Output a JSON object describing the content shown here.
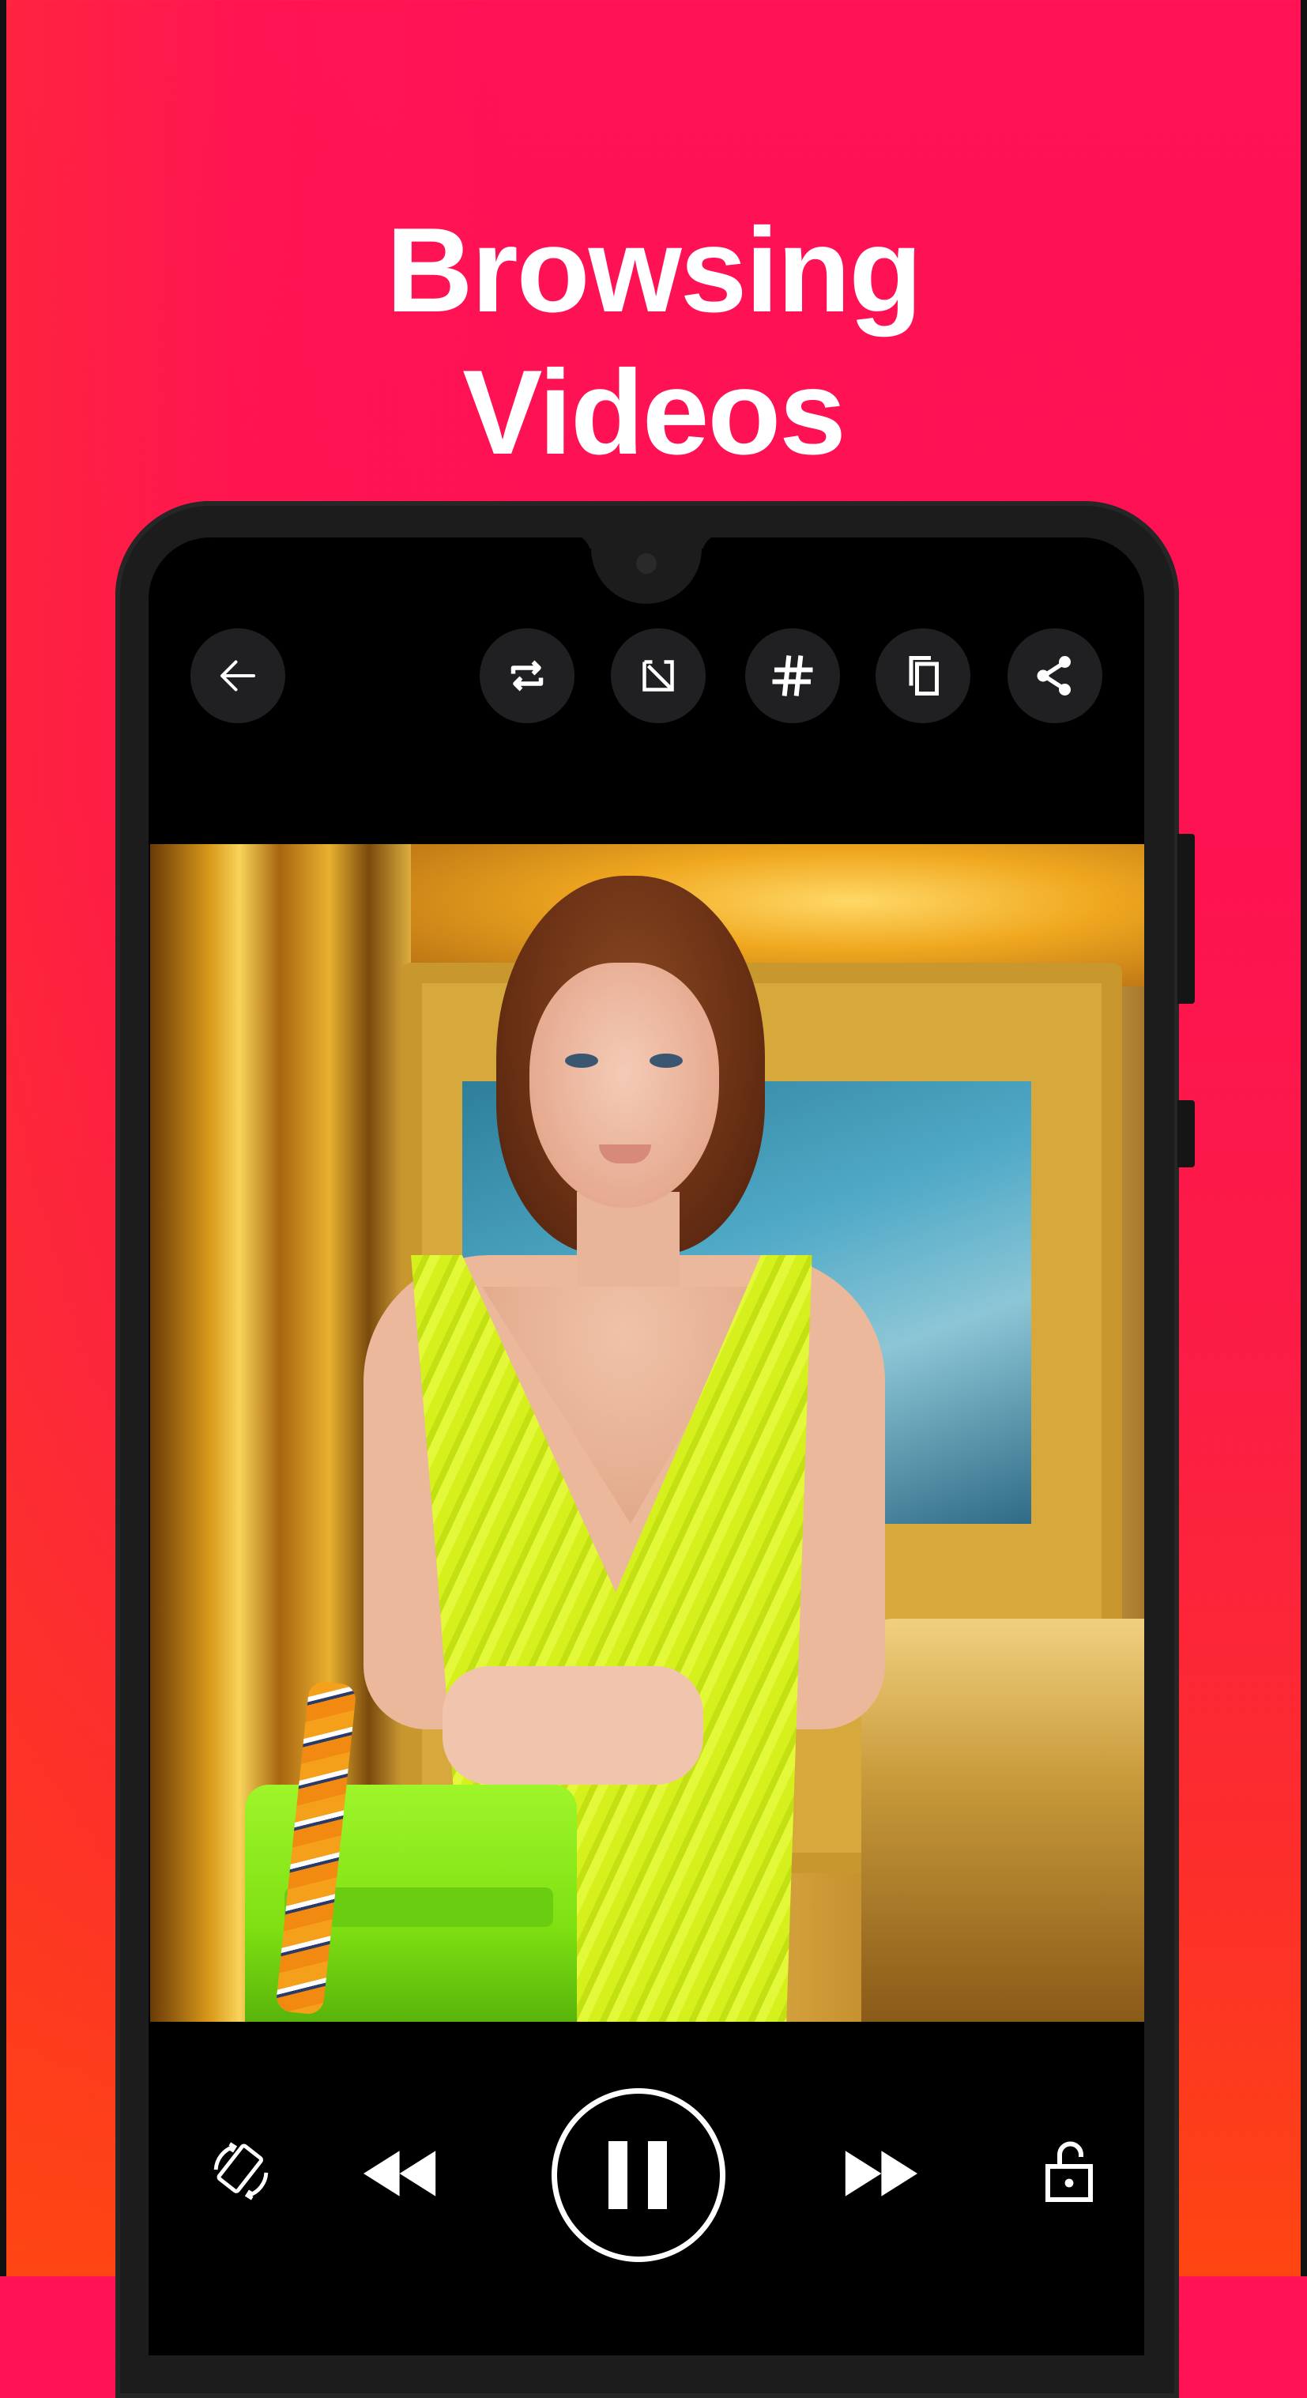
{
  "promo": {
    "headline_line1": "Browsing",
    "headline_line2": "Videos"
  },
  "colors": {
    "background_top": "#ff1256",
    "background_bottom": "#fe4611",
    "phone_bezel": "#1c1c1c",
    "toolbar_button_bg": "#202022",
    "icon_color": "#ffffff"
  },
  "player": {
    "state": "playing",
    "top_toolbar": [
      {
        "id": "back",
        "icon": "arrow-left-icon",
        "label": "Back"
      },
      {
        "id": "loop",
        "icon": "repeat-icon",
        "label": "Loop"
      },
      {
        "id": "resize",
        "icon": "aspect-resize-icon",
        "label": "Resize"
      },
      {
        "id": "hashtag",
        "icon": "hashtag-icon",
        "label": "Hashtags"
      },
      {
        "id": "copy",
        "icon": "copy-icon",
        "label": "Copy"
      },
      {
        "id": "share",
        "icon": "share-icon",
        "label": "Share"
      }
    ],
    "bottom_controls": [
      {
        "id": "rotate",
        "icon": "screen-rotation-icon",
        "label": "Rotate"
      },
      {
        "id": "rewind",
        "icon": "rewind-icon",
        "label": "Rewind"
      },
      {
        "id": "pause",
        "icon": "pause-icon",
        "label": "Pause"
      },
      {
        "id": "fast_forward",
        "icon": "fast-forward-icon",
        "label": "Fast forward"
      },
      {
        "id": "lock",
        "icon": "unlock-icon",
        "label": "Lock screen"
      }
    ],
    "video": {
      "description": "Woman in sequined lime dress holding green handbag in gold interior"
    }
  }
}
